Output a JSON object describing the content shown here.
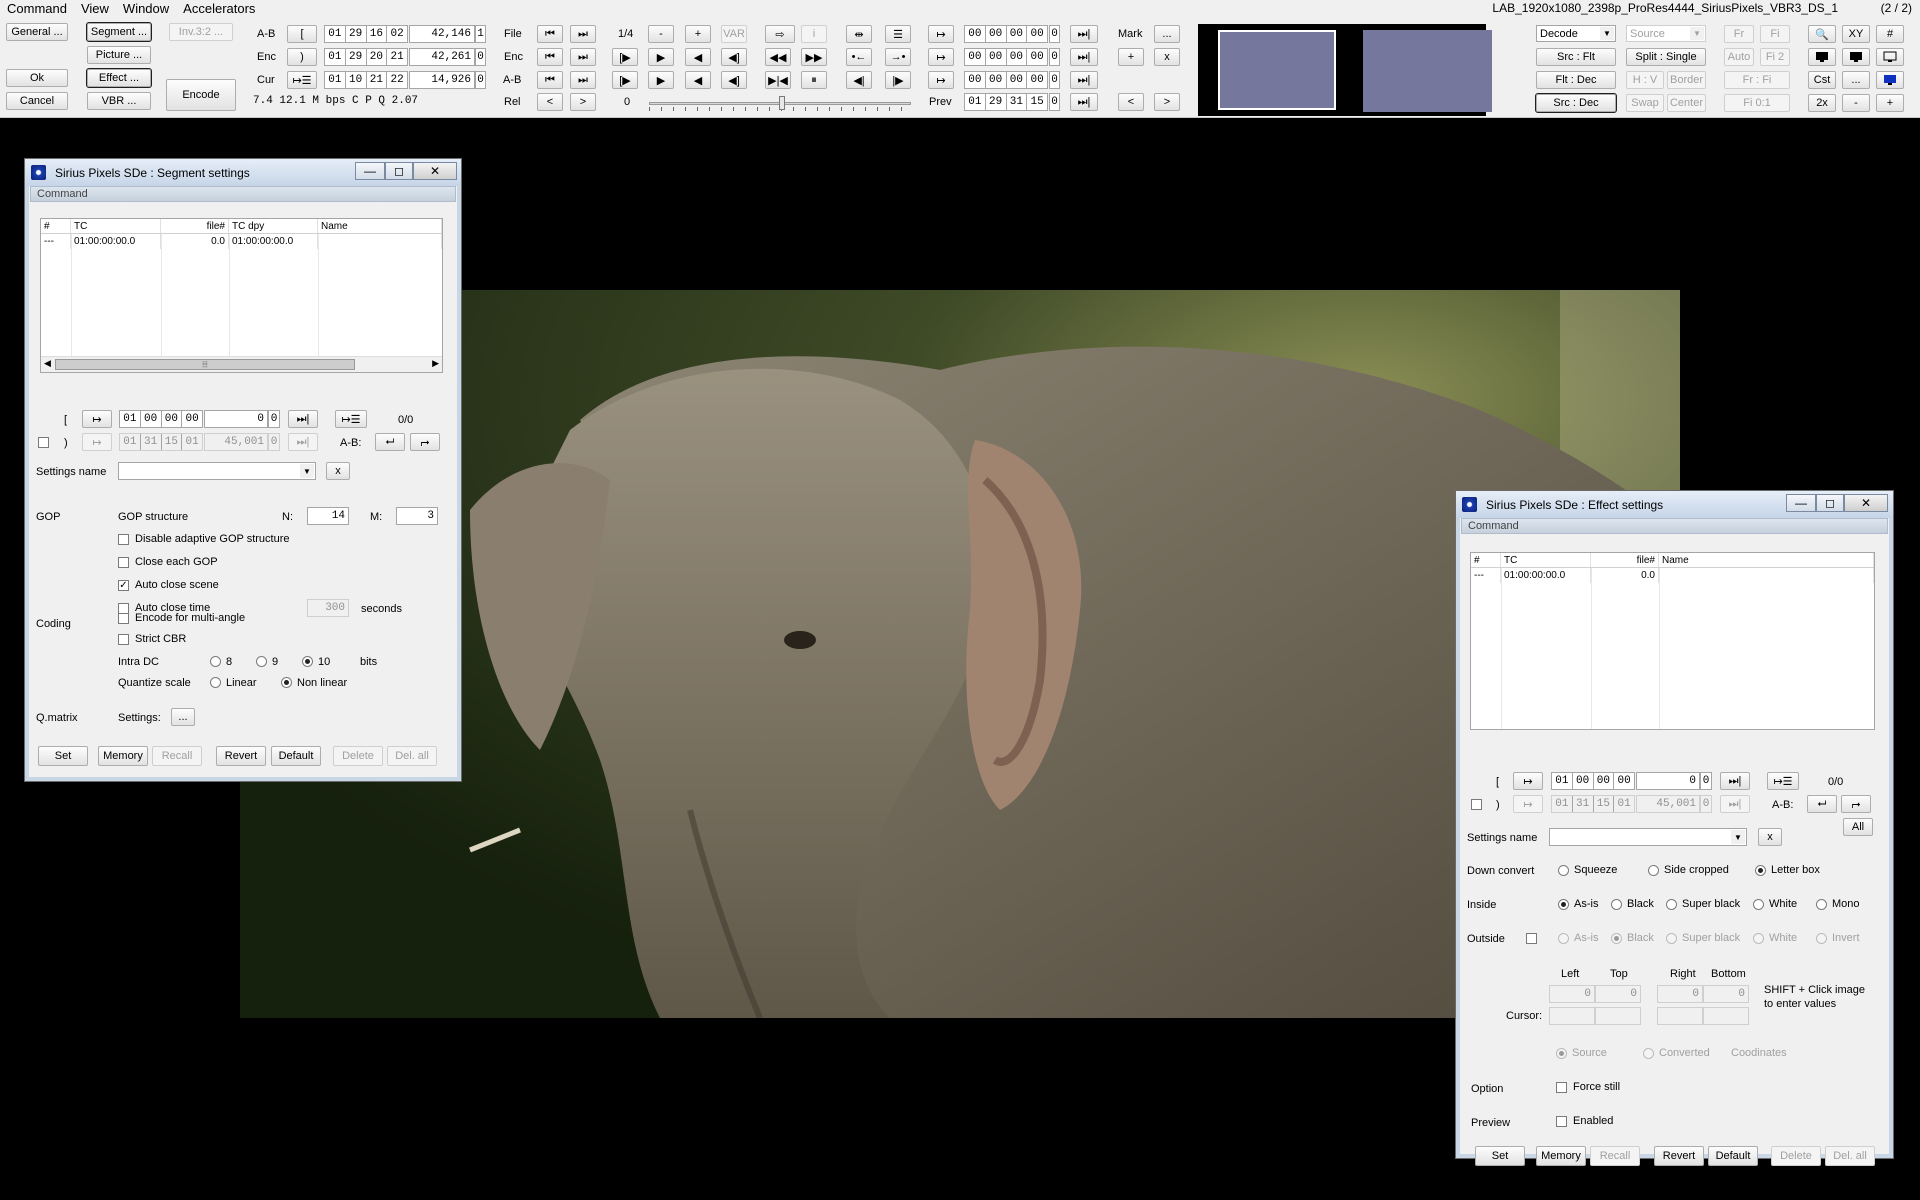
{
  "menu": {
    "items": [
      "Command",
      "View",
      "Window",
      "Accelerators"
    ],
    "file_title": "LAB_1920x1080_2398p_ProRes4444_SiriusPixels_VBR3_DS_1",
    "file_count": "(2 / 2)"
  },
  "toolbar": {
    "left_buttons": {
      "general": "General ...",
      "segment": "Segment ...",
      "inv": "Inv.3:2 ...",
      "picture": "Picture ...",
      "ok": "Ok",
      "effect": "Effect ...",
      "encode": "Encode",
      "cancel": "Cancel",
      "vbr": "VBR ..."
    },
    "tc_labels": {
      "ab": "A-B",
      "enc": "Enc",
      "cur": "Cur"
    },
    "tc_buttons": {
      "open": "[",
      "close": ")",
      "list": "↦☰"
    },
    "tc_rows": [
      {
        "tc": [
          "01",
          "29",
          "16",
          "02"
        ],
        "frames": "42,146",
        "ext": "1"
      },
      {
        "tc": [
          "01",
          "29",
          "20",
          "21"
        ],
        "frames": "42,261",
        "ext": "0"
      },
      {
        "tc": [
          "01",
          "10",
          "21",
          "22"
        ],
        "frames": "14,926",
        "ext": "0"
      }
    ],
    "status": "7.4  12.1 M bps   C P   Q  2.07",
    "nav_labels": {
      "file": "File",
      "enc": "Enc",
      "ab": "A-B",
      "rel": "Rel"
    },
    "speed": "1/4",
    "slider_value": "0",
    "controls": {
      "minus": "-",
      "plus": "+",
      "var": "VAR",
      "lt": "<",
      "gt": ">",
      "first": "⏮",
      "last": "⏭",
      "rew": "◀◀",
      "ff": "▶▶",
      "play": "▶",
      "back": "◀",
      "pause": "⏸",
      "step_back": "◀|",
      "step_fwd": "|▶",
      "mark_in": "[▶",
      "mark_out": "◀]",
      "bar_io": "▶|◀",
      "arrow_l": "•←",
      "arrow_r": "→•",
      "info": "i",
      "list_icon": "☰",
      "range_icon": "⇹",
      "loop_icon": "⇨"
    },
    "mark_tc": [
      {
        "tc": [
          "00",
          "00",
          "00",
          "00"
        ],
        "ext": "0"
      },
      {
        "tc": [
          "00",
          "00",
          "00",
          "00"
        ],
        "ext": "0"
      },
      {
        "tc": [
          "00",
          "00",
          "00",
          "00"
        ],
        "ext": "0"
      },
      {
        "tc": [
          "01",
          "29",
          "31",
          "15"
        ],
        "ext": "0"
      }
    ],
    "mark_labels": {
      "mark": "Mark",
      "more": "...",
      "plus": "+",
      "x": "x",
      "lt": "<",
      "gt": ">",
      "prev": "Prev",
      "goto": "↦",
      "jump": "⏭|"
    },
    "right": {
      "decode": "Decode",
      "source": "Source",
      "src_flt": "Src : Flt",
      "split_single": "Split : Single",
      "flt_dec": "Flt : Dec",
      "hv": "H : V",
      "border": "Border",
      "src_dec": "Src : Dec",
      "swap": "Swap",
      "center": "Center",
      "fr": "Fr",
      "fi": "Fi",
      "auto": "Auto",
      "fi2": "Fi 2",
      "frfi": "Fr : Fi",
      "fi01": "Fi 0:1",
      "zoom_icon": "🔍",
      "xy": "XY",
      "hash": "#",
      "cst": "Cst",
      "more": "...",
      "twox": "2x",
      "minus": "-",
      "plus": "+"
    }
  },
  "segment_window": {
    "title": "Sirius Pixels SDe : Segment settings",
    "command": "Command",
    "columns": [
      "#",
      "TC",
      "file#",
      "TC dpy",
      "Name"
    ],
    "rows": [
      {
        "num": "---",
        "tc": "01:00:00:00.0",
        "file": "0.0",
        "tc_dpy": "01:00:00:00.0",
        "name": ""
      }
    ],
    "in_tc": {
      "open": "[",
      "tc": [
        "01",
        "00",
        "00",
        "00"
      ],
      "frames": "0",
      "ext": "0",
      "count": "0/0"
    },
    "out_tc": {
      "close": ")",
      "tc": [
        "01",
        "31",
        "15",
        "01"
      ],
      "frames": "45,001",
      "ext": "0",
      "ab": "A-B:"
    },
    "settings_name_label": "Settings name",
    "settings_name_value": "",
    "x": "x",
    "gop": {
      "section": "GOP",
      "structure": "GOP structure",
      "n_label": "N:",
      "n": "14",
      "m_label": "M:",
      "m": "3",
      "disable_adaptive": "Disable adaptive GOP structure",
      "close_each": "Close each GOP",
      "auto_close_scene": "Auto close scene",
      "auto_close_time": "Auto close time",
      "time_value": "300",
      "seconds": "seconds"
    },
    "coding": {
      "section": "Coding",
      "multi_angle": "Encode for multi-angle",
      "strict_cbr": "Strict CBR",
      "intra_dc": "Intra DC",
      "dc8": "8",
      "dc9": "9",
      "dc10": "10",
      "bits": "bits",
      "quant_scale": "Quantize scale",
      "linear": "Linear",
      "non_linear": "Non linear"
    },
    "qmatrix": {
      "section": "Q.matrix",
      "settings": "Settings:",
      "more": "..."
    },
    "buttons": {
      "set": "Set",
      "memory": "Memory",
      "recall": "Recall",
      "revert": "Revert",
      "default": "Default",
      "delete": "Delete",
      "del_all": "Del. all"
    }
  },
  "effect_window": {
    "title": "Sirius Pixels SDe : Effect settings",
    "command": "Command",
    "columns": [
      "#",
      "TC",
      "file#",
      "Name"
    ],
    "rows": [
      {
        "num": "---",
        "tc": "01:00:00:00.0",
        "file": "0.0",
        "name": ""
      }
    ],
    "in_tc": {
      "open": "[",
      "tc": [
        "01",
        "00",
        "00",
        "00"
      ],
      "frames": "0",
      "ext": "0",
      "count": "0/0"
    },
    "out_tc": {
      "close": ")",
      "tc": [
        "01",
        "31",
        "15",
        "01"
      ],
      "frames": "45,001",
      "ext": "0",
      "ab": "A-B:"
    },
    "all": "All",
    "settings_name_label": "Settings name",
    "x": "x",
    "down_convert": {
      "label": "Down convert",
      "squeeze": "Squeeze",
      "side_cropped": "Side cropped",
      "letter_box": "Letter box"
    },
    "inside": {
      "label": "Inside",
      "as_is": "As-is",
      "black": "Black",
      "super_black": "Super black",
      "white": "White",
      "mono": "Mono"
    },
    "outside": {
      "label": "Outside",
      "as_is": "As-is",
      "black": "Black",
      "super_black": "Super black",
      "white": "White",
      "invert": "Invert"
    },
    "margins": {
      "left": "Left",
      "top": "Top",
      "right": "Right",
      "bottom": "Bottom",
      "left_v": "0",
      "top_v": "0",
      "right_v": "0",
      "bottom_v": "0",
      "cursor": "Cursor:",
      "hint": "SHIFT + Click image to enter values"
    },
    "coords": {
      "source": "Source",
      "converted": "Converted",
      "coordinates": "Coodinates"
    },
    "option": {
      "label": "Option",
      "force_still": "Force still"
    },
    "preview": {
      "label": "Preview",
      "enabled": "Enabled"
    },
    "buttons": {
      "set": "Set",
      "memory": "Memory",
      "recall": "Recall",
      "revert": "Revert",
      "default": "Default",
      "delete": "Delete",
      "del_all": "Del. all"
    }
  },
  "window_buttons": {
    "min": "—",
    "max": "◻",
    "close": "✕"
  }
}
